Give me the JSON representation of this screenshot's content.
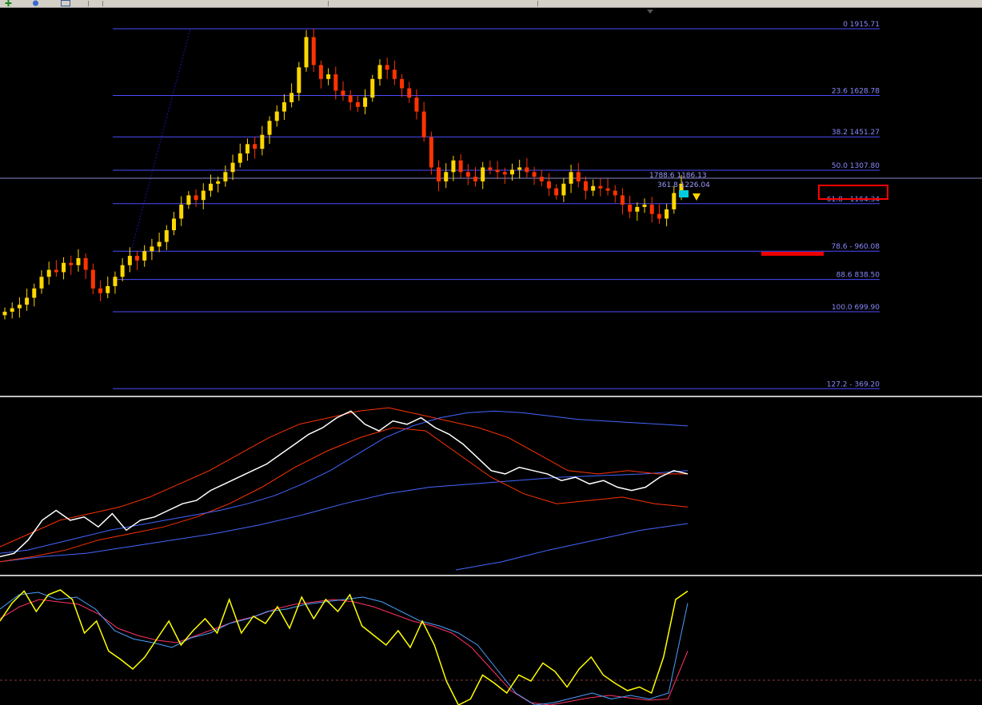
{
  "colors": {
    "background": "#000000",
    "bull_candle": "#ffd700",
    "bear_candle": "#ff3300",
    "fib_line": "#4c4cff",
    "fib_label": "#8a8aff",
    "bb_middle": "#4466ff",
    "bb_band": "#ff3300",
    "price_line": "#ffffff",
    "osc_main": "#ffff00",
    "osc_signal_1": "#4aa0ff",
    "osc_signal_2": "#ff3366",
    "highlight": "#ff0000"
  },
  "toolbar": {
    "icons": [
      "plus-icon",
      "globe-icon",
      "window-icon"
    ]
  },
  "chart_data": [
    {
      "type": "candlestick",
      "title": "",
      "fibonacci_levels": [
        {
          "label": "0 1915.71",
          "level": 0,
          "price": 1915.71
        },
        {
          "label": "23.6 1628.78",
          "level": 23.6,
          "price": 1628.78
        },
        {
          "label": "38.2 1451.27",
          "level": 38.2,
          "price": 1451.27
        },
        {
          "label": "50.0 1307.80",
          "level": 50.0,
          "price": 1307.8
        },
        {
          "label": "61.8 - 1164.34",
          "level": 61.8,
          "price": 1164.34
        },
        {
          "label": "78.6 - 960.08",
          "level": 78.6,
          "price": 960.08
        },
        {
          "label": "88.6 838.50",
          "level": 88.6,
          "price": 838.5
        },
        {
          "label": "100.0 699.90",
          "level": 100.0,
          "price": 699.9
        },
        {
          "label": "127.2 - 369.20",
          "level": 127.2,
          "price": 369.2
        }
      ],
      "price_readouts": [
        "1788.6 1186.13",
        "361.8 1226.04"
      ],
      "close": [
        700,
        715,
        730,
        760,
        800,
        850,
        880,
        870,
        910,
        900,
        930,
        880,
        800,
        780,
        810,
        850,
        900,
        940,
        920,
        960,
        980,
        1000,
        1050,
        1100,
        1160,
        1200,
        1180,
        1220,
        1250,
        1260,
        1300,
        1340,
        1380,
        1420,
        1400,
        1460,
        1520,
        1560,
        1600,
        1640,
        1750,
        1880,
        1760,
        1700,
        1720,
        1650,
        1630,
        1600,
        1580,
        1620,
        1700,
        1760,
        1740,
        1700,
        1660,
        1620,
        1560,
        1450,
        1320,
        1260,
        1300,
        1350,
        1300,
        1280,
        1260,
        1320,
        1310,
        1300,
        1290,
        1310,
        1320,
        1300,
        1280,
        1260,
        1230,
        1200,
        1250,
        1300,
        1260,
        1220,
        1240,
        1230,
        1220,
        1200,
        1160,
        1130,
        1150,
        1160,
        1120,
        1100,
        1140,
        1210,
        1250
      ]
    },
    {
      "type": "line",
      "title": "",
      "series": [
        {
          "key": "price",
          "values": [
            0.08,
            0.1,
            0.18,
            0.3,
            0.36,
            0.3,
            0.32,
            0.26,
            0.34,
            0.24,
            0.3,
            0.32,
            0.36,
            0.4,
            0.42,
            0.48,
            0.52,
            0.56,
            0.6,
            0.64,
            0.7,
            0.76,
            0.82,
            0.86,
            0.92,
            0.96,
            0.88,
            0.84,
            0.9,
            0.88,
            0.92,
            0.86,
            0.82,
            0.76,
            0.68,
            0.6,
            0.58,
            0.62,
            0.6,
            0.58,
            0.54,
            0.56,
            0.52,
            0.54,
            0.5,
            0.48,
            0.5,
            0.56,
            0.6,
            0.58
          ]
        },
        {
          "key": "bb_middle",
          "values": [
            0.1,
            0.12,
            0.16,
            0.2,
            0.24,
            0.27,
            0.3,
            0.33,
            0.36,
            0.4,
            0.45,
            0.52,
            0.6,
            0.7,
            0.8,
            0.87,
            0.92,
            0.95,
            0.96,
            0.95,
            0.93,
            0.91,
            0.9,
            0.89,
            0.88,
            0.87
          ]
        },
        {
          "key": "bb_upper",
          "values": [
            0.14,
            0.22,
            0.3,
            0.34,
            0.38,
            0.44,
            0.52,
            0.6,
            0.7,
            0.8,
            0.88,
            0.92,
            0.96,
            0.98,
            0.94,
            0.9,
            0.86,
            0.8,
            0.7,
            0.6,
            0.58,
            0.6,
            0.58,
            0.58
          ]
        },
        {
          "key": "bb_lower",
          "values": [
            0.05,
            0.08,
            0.12,
            0.18,
            0.22,
            0.26,
            0.32,
            0.4,
            0.5,
            0.62,
            0.72,
            0.8,
            0.86,
            0.84,
            0.7,
            0.56,
            0.46,
            0.4,
            0.42,
            0.44,
            0.4,
            0.38
          ]
        },
        {
          "key": "slow_upper",
          "values": [
            0.05,
            0.08,
            0.1,
            0.14,
            0.18,
            0.22,
            0.27,
            0.33,
            0.4,
            0.46,
            0.5,
            0.52,
            0.54,
            0.56,
            0.57,
            0.58,
            0.6
          ]
        },
        {
          "key": "slow_lower",
          "values": [
            0.0,
            0.05,
            0.12,
            0.18,
            0.24,
            0.28
          ]
        }
      ]
    },
    {
      "type": "line",
      "title": "",
      "series": [
        {
          "key": "main",
          "values": [
            0.7,
            0.85,
            0.95,
            0.78,
            0.92,
            0.96,
            0.88,
            0.6,
            0.7,
            0.45,
            0.38,
            0.3,
            0.4,
            0.55,
            0.7,
            0.5,
            0.62,
            0.72,
            0.6,
            0.88,
            0.6,
            0.74,
            0.68,
            0.82,
            0.64,
            0.9,
            0.72,
            0.88,
            0.78,
            0.92,
            0.66,
            0.58,
            0.5,
            0.62,
            0.48,
            0.7,
            0.5,
            0.2,
            0.0,
            0.05,
            0.25,
            0.18,
            0.1,
            0.25,
            0.2,
            0.35,
            0.28,
            0.15,
            0.3,
            0.4,
            0.25,
            0.18,
            0.12,
            0.15,
            0.1,
            0.4,
            0.88,
            0.95
          ]
        },
        {
          "key": "signal_1",
          "values": [
            0.8,
            0.92,
            0.94,
            0.88,
            0.9,
            0.8,
            0.62,
            0.55,
            0.52,
            0.48,
            0.56,
            0.6,
            0.68,
            0.72,
            0.78,
            0.8,
            0.84,
            0.86,
            0.88,
            0.9,
            0.86,
            0.78,
            0.7,
            0.66,
            0.6,
            0.5,
            0.3,
            0.1,
            0.0,
            0.02,
            0.06,
            0.1,
            0.05,
            0.08,
            0.05,
            0.1,
            0.85
          ]
        },
        {
          "key": "signal_2",
          "values": [
            0.72,
            0.82,
            0.88,
            0.86,
            0.84,
            0.76,
            0.64,
            0.58,
            0.54,
            0.52,
            0.58,
            0.64,
            0.7,
            0.74,
            0.8,
            0.84,
            0.86,
            0.88,
            0.86,
            0.82,
            0.76,
            0.7,
            0.66,
            0.6,
            0.48,
            0.3,
            0.12,
            0.02,
            0.0,
            0.03,
            0.06,
            0.08,
            0.06,
            0.04,
            0.05,
            0.45
          ]
        }
      ]
    }
  ]
}
